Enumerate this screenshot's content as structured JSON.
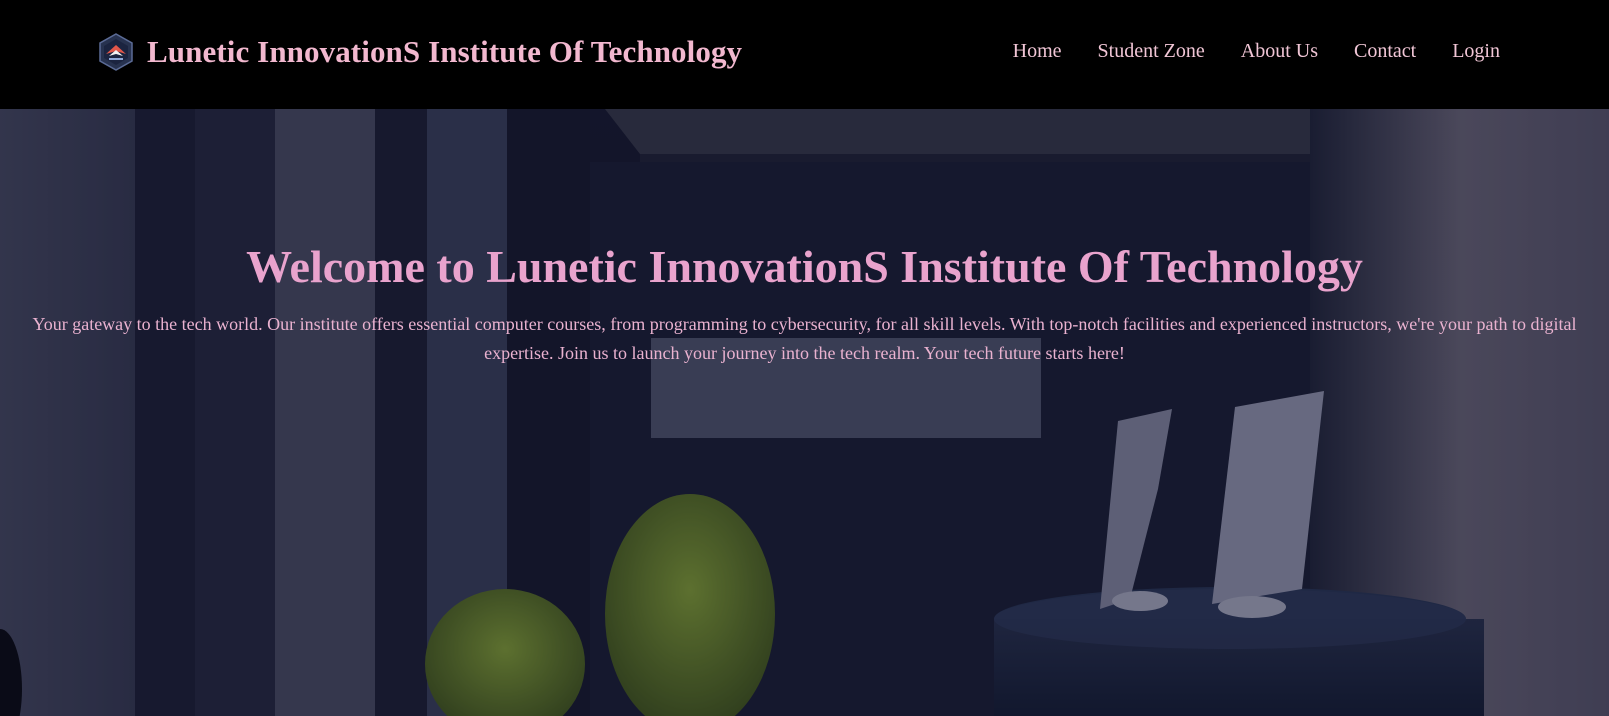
{
  "header": {
    "brand_title": "Lunetic InnovationS Institute Of Technology",
    "logo_icon": "institute-logo-icon"
  },
  "nav": {
    "items": [
      {
        "label": "Home"
      },
      {
        "label": "Student Zone"
      },
      {
        "label": "About Us"
      },
      {
        "label": "Contact"
      },
      {
        "label": "Login"
      }
    ]
  },
  "hero": {
    "title": "Welcome to Lunetic InnovationS Institute Of Technology",
    "description_line1": "Your gateway to the tech world. Our institute offers essential computer courses, from programming to cybersecurity, for all skill levels. With top-notch facilities and experienced instructors, we're your path to digital",
    "description_line2": "expertise. Join us to launch your journey into the tech realm. Your tech future starts here!"
  },
  "colors": {
    "navbar_bg": "#000000",
    "brand_text": "#f2b8cf",
    "nav_text": "#f1c6d6",
    "hero_title": "#e9a3cd",
    "hero_text": "#eab2d0"
  }
}
